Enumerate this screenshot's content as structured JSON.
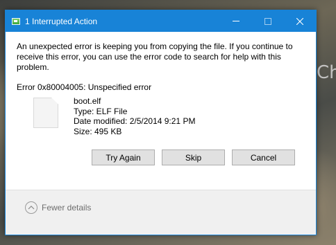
{
  "window": {
    "title": "1 Interrupted Action"
  },
  "desktop": {
    "partial_text": "Ch"
  },
  "message": {
    "body": "An unexpected error is keeping you from copying the file. If you continue to receive this error, you can use the error code to search for help with this problem.",
    "error": "Error 0x80004005: Unspecified error"
  },
  "file": {
    "name": "boot.elf",
    "type": "Type: ELF File",
    "modified": "Date modified: 2/5/2014 9:21 PM",
    "size": "Size: 495 KB"
  },
  "buttons": {
    "try_again": "Try Again",
    "skip": "Skip",
    "cancel": "Cancel"
  },
  "footer": {
    "details_label": "Fewer details"
  },
  "icons": {
    "title": "file-copy-icon",
    "file": "generic-file-icon",
    "toggle": "chevron-up-icon"
  },
  "colors": {
    "titlebar": "#1883d7",
    "button_face": "#e1e1e1",
    "footer": "#f0f0f0"
  }
}
